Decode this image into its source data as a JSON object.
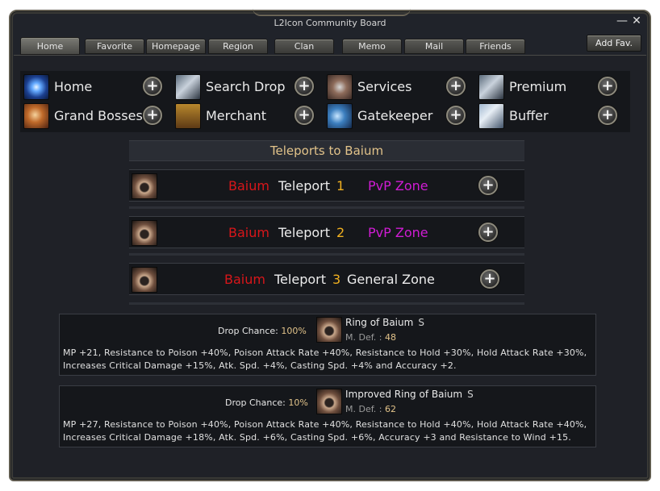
{
  "window": {
    "title": "L2Icon Community Board"
  },
  "tabs": [
    {
      "label": "Home"
    },
    {
      "label": "Favorite"
    },
    {
      "label": "Homepage"
    },
    {
      "label": "Region"
    },
    {
      "label": "Clan"
    },
    {
      "label": "Memo"
    },
    {
      "label": "Mail"
    },
    {
      "label": "Friends"
    }
  ],
  "add_fav_label": "Add Fav.",
  "menu": [
    {
      "label": "Home",
      "icon": "home-icon"
    },
    {
      "label": "Search Drop",
      "icon": "search-drop-icon"
    },
    {
      "label": "Services",
      "icon": "services-icon"
    },
    {
      "label": "Premium",
      "icon": "premium-icon"
    },
    {
      "label": "Grand Bosses",
      "icon": "grand-bosses-icon"
    },
    {
      "label": "Merchant",
      "icon": "merchant-icon"
    },
    {
      "label": "Gatekeeper",
      "icon": "gatekeeper-icon"
    },
    {
      "label": "Buffer",
      "icon": "buffer-icon"
    }
  ],
  "section_title": "Teleports to Baium",
  "teleports": [
    {
      "boss": "Baium",
      "word": "Teleport",
      "num": "1",
      "zone": "PvP Zone"
    },
    {
      "boss": "Baium",
      "word": "Teleport",
      "num": "2",
      "zone": "PvP Zone"
    },
    {
      "boss": "Baium",
      "word": "Teleport",
      "num": "3",
      "zone": "General Zone"
    }
  ],
  "drops": [
    {
      "label": "Drop Chance:",
      "chance": "100%",
      "item_name": "Ring of Baium",
      "grade": "S",
      "def_label": "M. Def. :",
      "def_value": "48",
      "desc1": "MP +21, Resistance to Poison +40%, Poison Attack Rate +40%, Resistance to Hold +30%, Hold Attack Rate +30%,",
      "desc2": "Increases Critical Damage +15%, Atk. Spd. +4%, Casting Spd. +4% and Accuracy +2."
    },
    {
      "label": "Drop Chance:",
      "chance": "10%",
      "item_name": "Improved Ring of Baium",
      "grade": "S",
      "def_label": "M. Def. :",
      "def_value": "62",
      "desc1": "MP +27, Resistance to Poison +40%, Poison Attack Rate +40%, Resistance to Hold +40%, Hold Attack Rate +40%,",
      "desc2": "Increases Critical Damage +18%, Atk. Spd. +6%, Casting Spd. +6%, Accuracy +3 and Resistance to Wind +15."
    }
  ]
}
